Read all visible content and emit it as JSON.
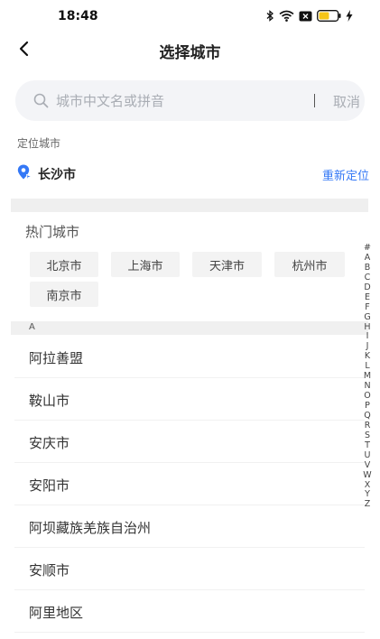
{
  "status_bar": {
    "time": "18:48",
    "icons": [
      "bluetooth-icon",
      "wifi-icon",
      "sim-icon",
      "battery-icon",
      "charging-icon"
    ],
    "battery_color": "#f5c518"
  },
  "header": {
    "title": "选择城市"
  },
  "search": {
    "placeholder": "城市中文名或拼音",
    "divider": "|",
    "cancel_label": "取消"
  },
  "location": {
    "heading": "定位城市",
    "current_city": "长沙市",
    "relocate_label": "重新定位",
    "accent_color": "#3478f6"
  },
  "hot_cities": {
    "heading": "热门城市",
    "items": [
      "北京市",
      "上海市",
      "天津市",
      "杭州市",
      "南京市"
    ]
  },
  "city_list": {
    "section_letter": "A",
    "items": [
      "阿拉善盟",
      "鞍山市",
      "安庆市",
      "安阳市",
      "阿坝藏族羌族自治州",
      "安顺市",
      "阿里地区"
    ]
  },
  "index_bar": [
    "#",
    "A",
    "B",
    "C",
    "D",
    "E",
    "F",
    "G",
    "H",
    "I",
    "J",
    "K",
    "L",
    "M",
    "N",
    "O",
    "P",
    "Q",
    "R",
    "S",
    "T",
    "U",
    "V",
    "W",
    "X",
    "Y",
    "Z"
  ]
}
